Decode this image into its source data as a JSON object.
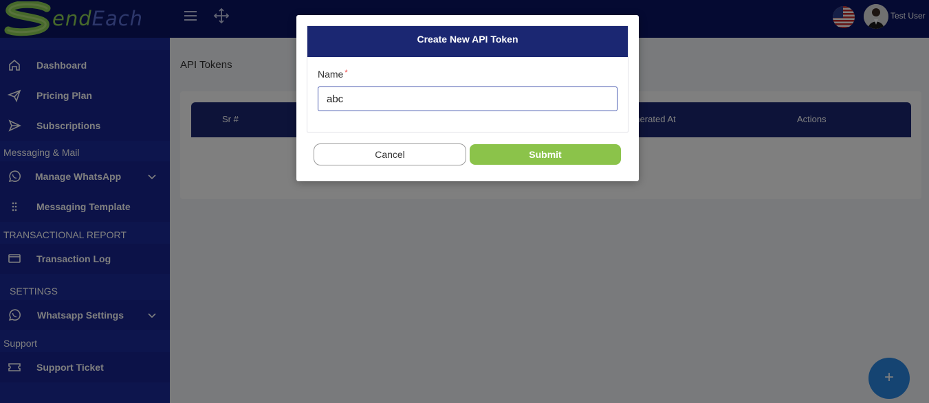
{
  "app": {
    "logo_first": "S",
    "logo_send": "end",
    "logo_each": "Each"
  },
  "topbar": {
    "menu_icon": "hamburger-icon",
    "move_icon": "move-arrows-icon",
    "flag_icon": "us-flag-icon",
    "username": "Test User"
  },
  "sidebar": {
    "items": [
      {
        "label": "Dashboard",
        "icon": "home-icon"
      },
      {
        "label": "Pricing Plan",
        "icon": "paper-plane-icon"
      },
      {
        "label": "Subscriptions",
        "icon": "send-icon"
      },
      {
        "label": "Manage WhatsApp",
        "icon": "whatsapp-icon"
      },
      {
        "label": "Messaging Template",
        "icon": "grip-dots-icon"
      },
      {
        "label": "Transaction Log",
        "icon": "credit-card-icon"
      },
      {
        "label": "Whatsapp Settings",
        "icon": "whatsapp-icon"
      },
      {
        "label": "Support Ticket",
        "icon": "ticket-icon"
      }
    ],
    "sections": [
      "Messaging & Mail",
      "TRANSACTIONAL REPORT",
      "SETTINGS",
      "Support"
    ]
  },
  "main": {
    "page_title": "API Tokens",
    "table": {
      "columns": [
        "Sr #",
        "Generated At",
        "Actions"
      ]
    },
    "fab_label": "+"
  },
  "modal": {
    "title": "Create New API Token",
    "field_label": "Name",
    "required_mark": "*",
    "input_value": "abc",
    "cancel_label": "Cancel",
    "submit_label": "Submit"
  },
  "colors": {
    "topbar": "#0a1464",
    "sidebar": "#1a2a9a",
    "header": "#1b2772",
    "submit": "#8bc34a",
    "fab": "#2b89e4"
  }
}
